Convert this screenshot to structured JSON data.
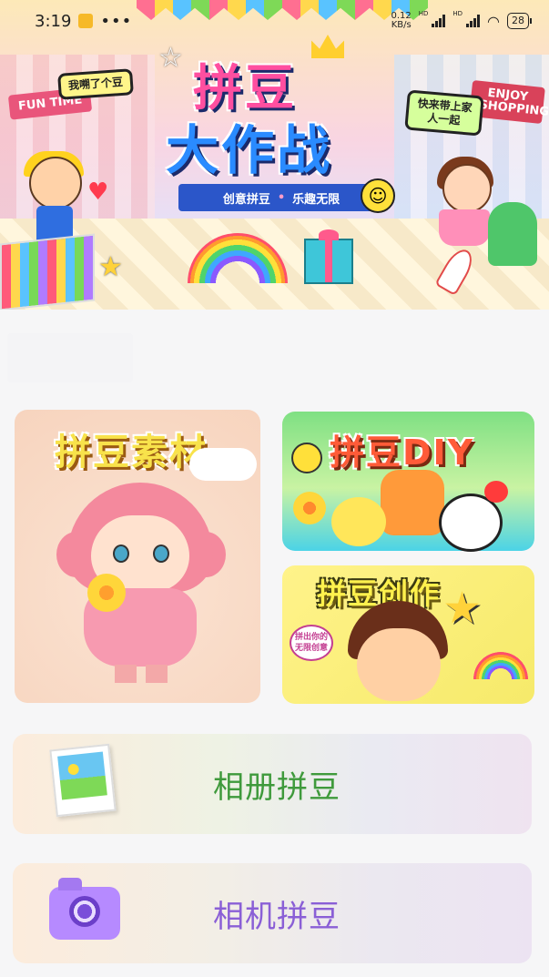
{
  "status_bar": {
    "time": "3:19",
    "dots": "•••",
    "net_speed": "0.12",
    "net_unit": "KB/s",
    "hd1": "HD",
    "hd2": "HD",
    "battery": "28"
  },
  "banner": {
    "title_line1": "拼豆",
    "title_line2": "大作战",
    "subtitle_left": "创意拼豆",
    "subtitle_sep": "•",
    "subtitle_right": "乐趣无限",
    "bubble_left": "我嗍了个豆",
    "bubble_right": "快来带上家人一起",
    "sign_left": "FUN TIME",
    "sign_right": "ENJOY SHOPPING"
  },
  "cards": {
    "material": {
      "label": "拼豆素材"
    },
    "diy": {
      "label": "拼豆DIY"
    },
    "create": {
      "label": "拼豆创作",
      "badge": "拼出你的无限创意"
    }
  },
  "actions": {
    "album": {
      "label": "相册拼豆",
      "icon": "photo-album-icon",
      "color": "#3f9a3c"
    },
    "camera": {
      "label": "相机拼豆",
      "icon": "camera-icon",
      "color": "#8a5fd6"
    }
  }
}
